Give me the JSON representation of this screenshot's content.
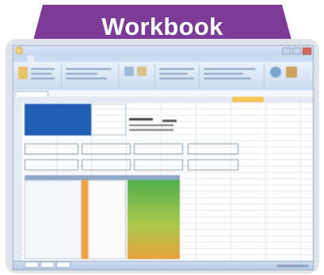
{
  "banner": {
    "title": "Workbook"
  },
  "colors": {
    "banner": "#7b3b97",
    "frame": "#dfe3ea",
    "header_cells": "#1f5fb3",
    "data_fill_top": "#5cb85c",
    "data_fill_bottom": "#e8a13c",
    "orange_marker": "#f2a33a"
  },
  "icons": [
    "office-button-icon",
    "ribbon-paste-icon",
    "ribbon-table-icon",
    "ribbon-chart-icon",
    "ribbon-sort-icon",
    "ribbon-filter-icon"
  ]
}
